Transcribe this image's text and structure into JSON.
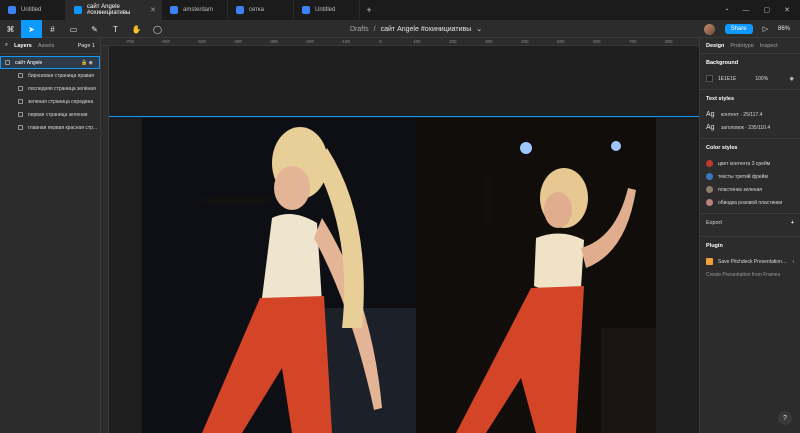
{
  "tabs": [
    {
      "label": "Untitled",
      "active": false
    },
    {
      "label": "сайт Angele #охинициативы",
      "active": true
    },
    {
      "label": "amsterdam",
      "active": false
    },
    {
      "label": "сетка",
      "active": false
    },
    {
      "label": "Untitled",
      "active": false
    }
  ],
  "toolbar": {
    "breadcrumb_root": "Drafts",
    "separator": "/",
    "file_name": "сайт Angele #охинициативы",
    "share_label": "Share",
    "zoom": "86%"
  },
  "left_panel": {
    "tab_layers": "Layers",
    "tab_assets": "Assets",
    "page": "Page 1",
    "selected_layer": "сайт Angele",
    "layers": [
      "бирюзовая страница правая",
      "последняя страница зелёная",
      "зеленая страница середина",
      "первая страница зеленая",
      "главная первая красная стр..."
    ]
  },
  "ruler": {
    "ticks": [
      "-700",
      "-600",
      "-500",
      "-400",
      "-300",
      "-200",
      "-100",
      "0",
      "100",
      "200",
      "300",
      "400",
      "500",
      "600",
      "700",
      "800"
    ]
  },
  "right_panel": {
    "tab_design": "Design",
    "tab_prototype": "Prototype",
    "tab_inspect": "Inspect",
    "background_title": "Background",
    "background_hex": "1E1E1E",
    "background_opacity": "100%",
    "text_styles_title": "Text styles",
    "text_styles": [
      {
        "icon": "Ag",
        "label": "контент · 25/117.4"
      },
      {
        "icon": "Ag",
        "label": "заголовок · 235/110.4"
      }
    ],
    "color_styles_title": "Color styles",
    "color_styles": [
      {
        "label": "цвет контента 3 срейм",
        "color": "#c0392b"
      },
      {
        "label": "тексты третий фрейм",
        "color": "#3a78c2"
      },
      {
        "label": "пластинка зеленая",
        "color": "#8e7d6b"
      },
      {
        "label": "обводка розовой пластинки",
        "color": "#b9837c"
      }
    ],
    "export_title": "Export",
    "plugin_title": "Plugin",
    "plugin_name": "Save Pitchdeck Presentation...",
    "plugin_sub": "Create Presentation from Frames"
  },
  "colors": {
    "accent": "#0d99ff",
    "panel": "#2c2c2c",
    "canvas": "#1e1e1e"
  }
}
